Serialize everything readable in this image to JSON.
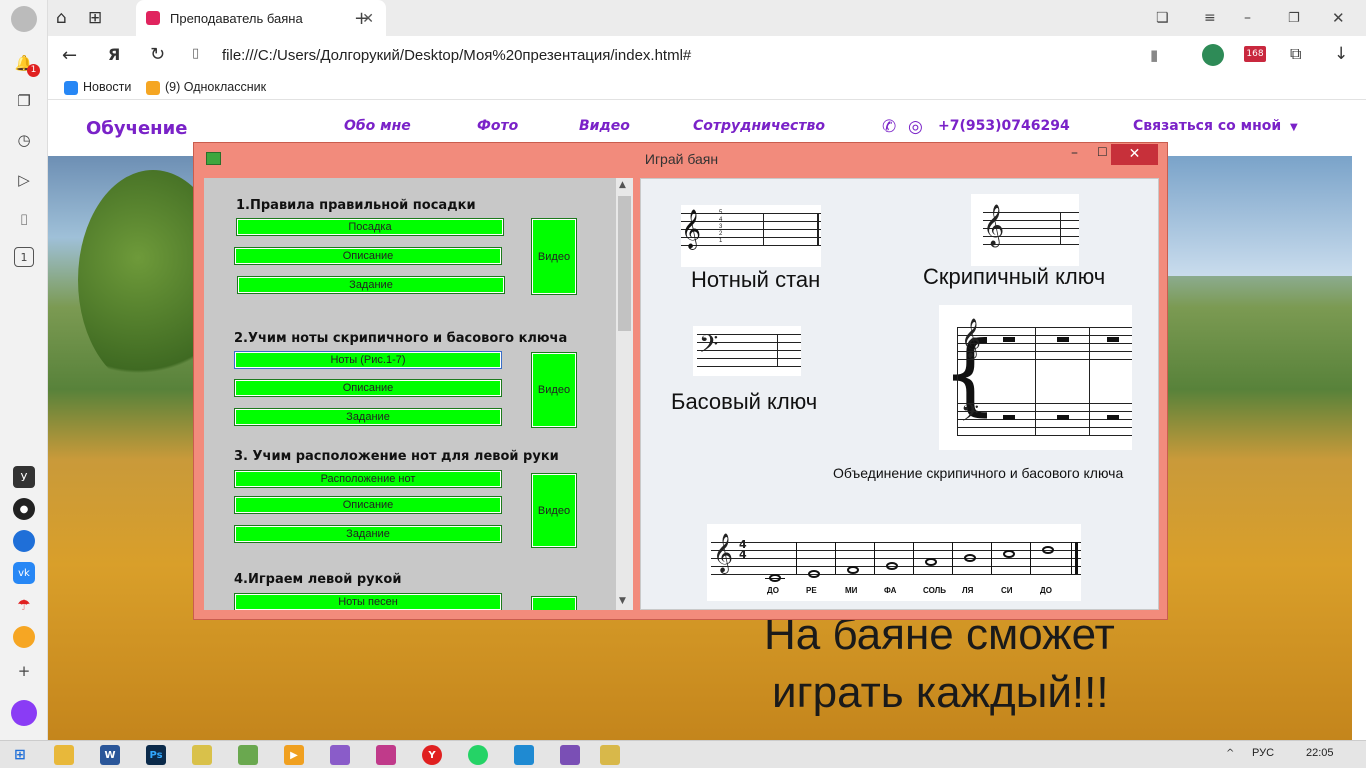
{
  "browser": {
    "tab_title": "Преподаватель баяна",
    "address": "file:///C:/Users/Долгорукий/Desktop/Моя%20презентация/index.html#",
    "bookmarks": [
      "Новости",
      "(9) Одноклассник"
    ],
    "notification_count": "1",
    "extension_badge": "168",
    "sidebar_counter": "1"
  },
  "site": {
    "brand": "Обучение",
    "nav": [
      "Обо мне",
      "Фото",
      "Видео",
      "Сотрудничество"
    ],
    "phone": "+7(953)0746294",
    "contact": "Связаться со мной",
    "slogan_line1": "На баяне сможет",
    "slogan_line2": "играть каждый!!!"
  },
  "app": {
    "title": "Играй баян",
    "sections": [
      {
        "title": "1.Правила правильной посадки",
        "buttons": [
          "Посадка",
          "Описание",
          "Задание"
        ],
        "video": "Видео"
      },
      {
        "title": "2.Учим ноты скрипичного и басового ключа",
        "buttons": [
          "Ноты (Рис.1-7)",
          "Описание",
          "Задание"
        ],
        "video": "Видео"
      },
      {
        "title": "3. Учим расположение нот для левой руки",
        "buttons": [
          "Расположение нот",
          "Описание",
          "Задание"
        ],
        "video": "Видео"
      },
      {
        "title": "4.Играем левой рукой",
        "buttons": [
          "Ноты песен"
        ],
        "video": ""
      }
    ],
    "figure": {
      "staff_caption": "Нотный стан",
      "treble_caption": "Скрипичный ключ",
      "bass_caption": "Басовый ключ",
      "combined_caption": "Объединение скрипичного и басового ключа",
      "line_numbers": [
        "5",
        "4",
        "3",
        "2",
        "1"
      ],
      "time_signature": [
        "4",
        "4"
      ],
      "notes": [
        "ДО",
        "РЕ",
        "МИ",
        "ФА",
        "СОЛЬ",
        "ЛЯ",
        "СИ",
        "ДО"
      ]
    }
  },
  "taskbar": {
    "language": "РУС",
    "time": "22:05"
  }
}
